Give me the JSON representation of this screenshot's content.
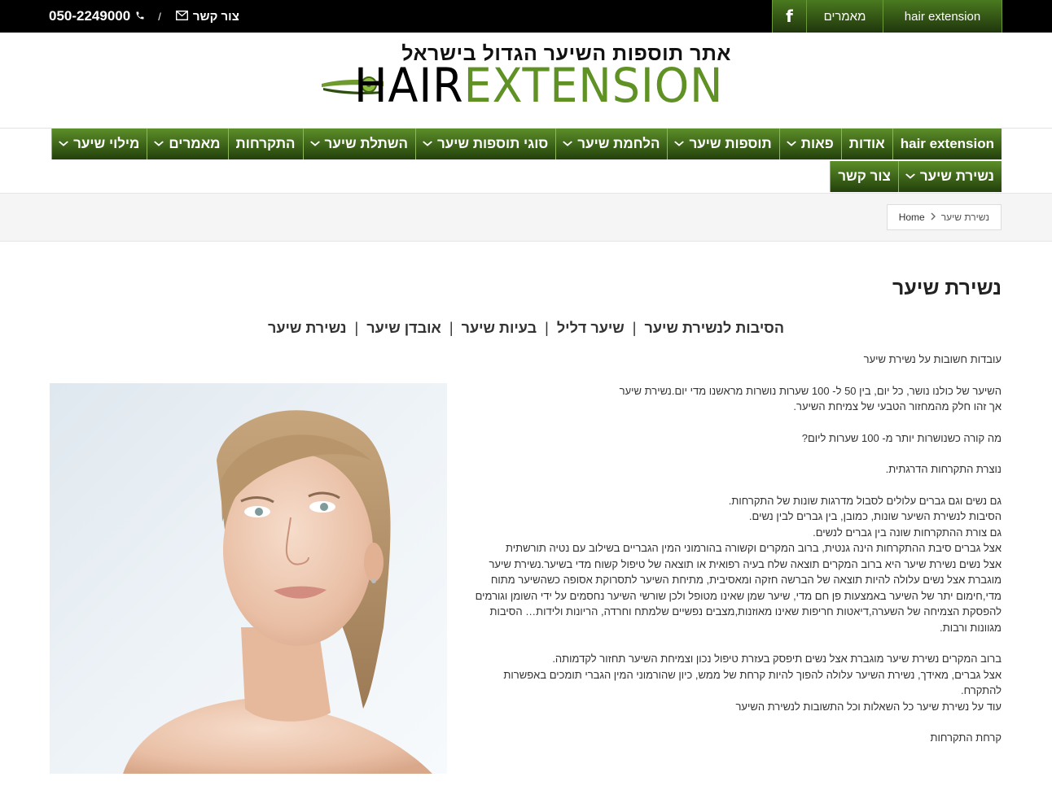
{
  "topbar": {
    "phone": "050-2249000",
    "separator": "/",
    "contact_label": "צור קשר",
    "nav": {
      "facebook": "f",
      "articles": "מאמרים",
      "hair_extension": "hair extension"
    }
  },
  "logo": {
    "tagline": "אתר תוספות השיער הגדול בישראל",
    "word_hair": "HAIR",
    "word_extension": "EXTENSION"
  },
  "mainnav": {
    "row1": [
      {
        "label": "hair extension",
        "dropdown": false
      },
      {
        "label": "אודות",
        "dropdown": false
      },
      {
        "label": "פאות",
        "dropdown": true
      },
      {
        "label": "תוספות שיער",
        "dropdown": true
      },
      {
        "label": "הלחמת שיער",
        "dropdown": true
      },
      {
        "label": "סוגי תוספות שיער",
        "dropdown": true
      },
      {
        "label": "השתלת שיער",
        "dropdown": true
      },
      {
        "label": "התקרחות",
        "dropdown": false
      },
      {
        "label": "מאמרים",
        "dropdown": true
      },
      {
        "label": "מילוי שיער",
        "dropdown": true
      }
    ],
    "row2": [
      {
        "label": "נשירת שיער",
        "dropdown": true
      },
      {
        "label": "צור קשר",
        "dropdown": false
      }
    ]
  },
  "breadcrumb": {
    "home": "Home",
    "current": "נשירת שיער"
  },
  "page_title": "נשירת שיער",
  "subnav": {
    "links": [
      "הסיבות לנשירת שיער",
      "שיער דליל",
      "בעיות שיער",
      "אובדן שיער",
      "נשירת שיער"
    ],
    "separator": "|"
  },
  "article": {
    "paragraphs": [
      [
        "עובדות חשובות על נשירת שיער"
      ],
      [
        "השיער של כולנו נושר, כל יום, בין 50 ל- 100 שערות נושרות מראשנו מדי יום.נשירת שיער",
        "אך זהו חלק מהמחזור הטבעי של צמיחת השיער."
      ],
      [
        "מה קורה כשנושרות יותר מ- 100 שערות ליום?"
      ],
      [
        "נוצרת התקרחות הדרגתית."
      ],
      [
        "גם נשים וגם גברים עלולים לסבול מדרגות שונות של התקרחות.",
        "הסיבות לנשירת השיער שונות, כמובן, בין גברים לבין נשים.",
        "גם צורת ההתקרחות שונה בין גברים לנשים.",
        "אצל גברים סיבת ההתקרחות הינה גנטית, ברוב המקרים וקשורה בהורמוני המין הגבריים בשילוב עם נטיה תורשתית",
        "אצל נשים נשירת שיער היא ברוב המקרים תוצאה שלח בעיה רפואית או תוצאה של טיפול קשוח מדי בשיער.נשירת שיער",
        "מוגברת אצל נשים עלולה להיות תוצאה של הברשה חזקה ומאסיבית, מתיחת השיער לתסרוקת אסופה כשהשיער מתוח",
        "מדי,חימום יתר של השיער באמצעות פן חם מדי, שיער שמן שאינו מטופל ולכן שורשי השיער נחסמים על ידי השומן וגורמים",
        "להפסקת הצמיחה של השערה,דיאטות חריפות שאינו מאוזנות,מצבים נפשיים שלמתח וחרדה, הריונות ולידות… הסיבות",
        "מגוונות ורבות."
      ],
      [
        "ברוב המקרים נשירת שיער מוגברת אצל נשים תיפסק בעזרת טיפול נכון וצמיחת השיער תחזור לקדמותה.",
        "אצל גברים, מאידך, נשירת השיער עלולה להפוך להיות קרחת של ממש, כיון שהורמוני המין הגברי תומכים באפשרות",
        "להתקרח.",
        "עוד על נשירת שיער כל השאלות וכל התשובות לנשירת השיער"
      ],
      [
        "קרחת התקרחות"
      ]
    ]
  },
  "colors": {
    "topbar_bg": "#000000",
    "nav_green_top": "#5c8e28",
    "nav_green_bottom": "#23400c",
    "logo_green": "#5f9124"
  },
  "icons": [
    "phone-icon",
    "envelope-icon",
    "facebook-icon",
    "chevron-down-icon",
    "chevron-right-icon"
  ]
}
